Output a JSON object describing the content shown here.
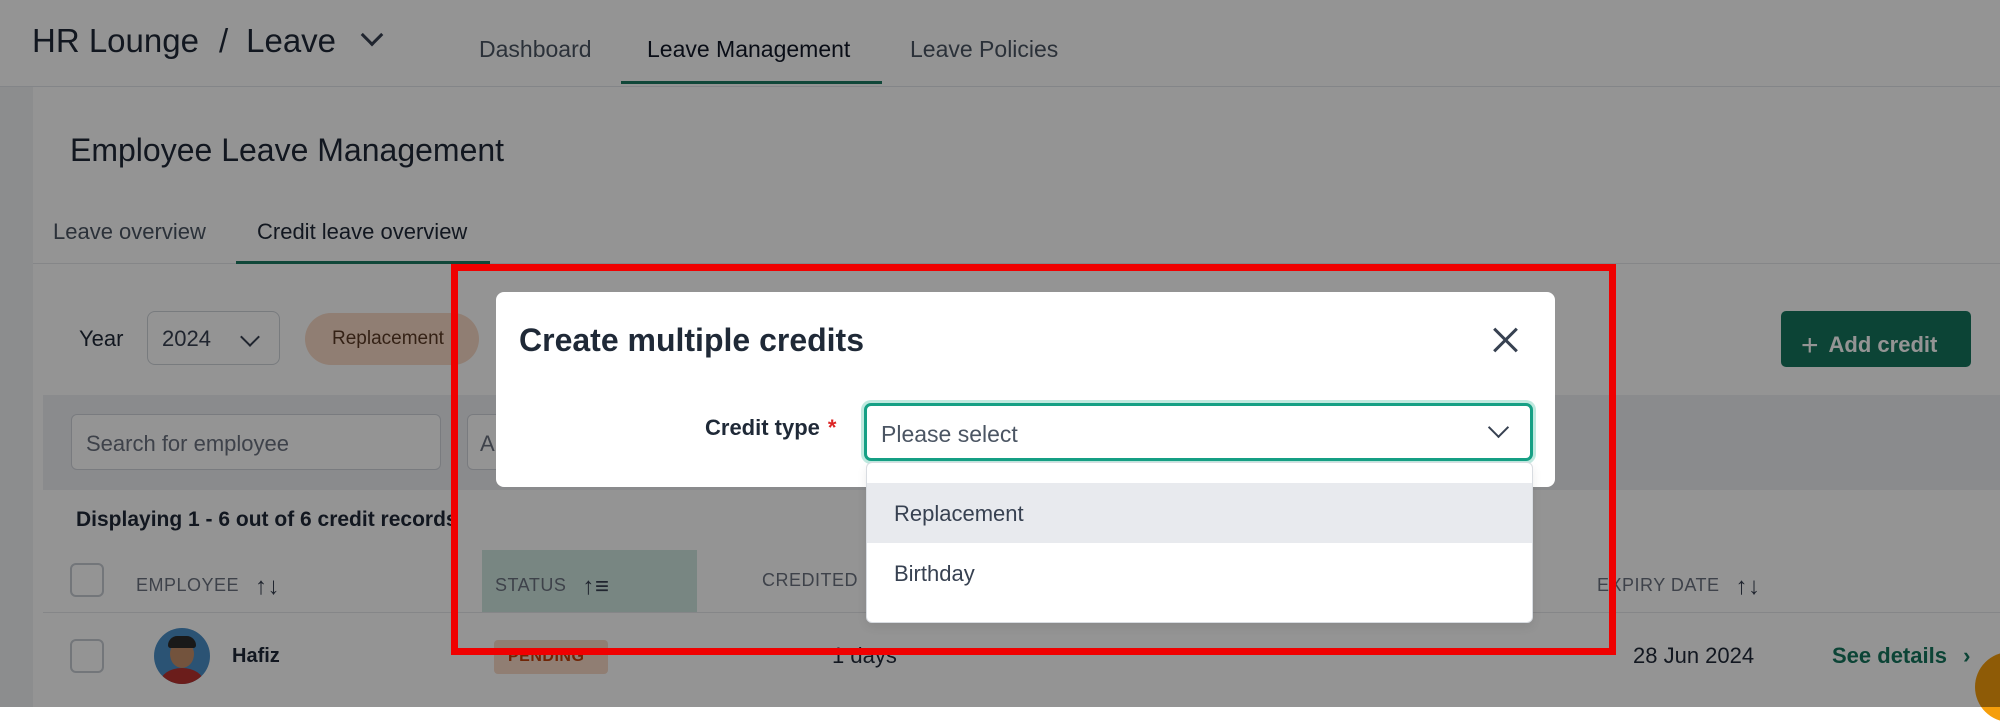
{
  "breadcrumb": {
    "home": "HR Lounge",
    "separator": "/",
    "section": "Leave"
  },
  "nav_tabs": [
    "Dashboard",
    "Leave Management",
    "Leave Policies"
  ],
  "page_title": "Employee Leave Management",
  "sub_tabs": [
    "Leave overview",
    "Credit leave overview"
  ],
  "filters": {
    "year_label": "Year",
    "year_value": "2024",
    "type_pill": "Replacement",
    "search_placeholder": "Search for employee",
    "second_search_placeholder": "A"
  },
  "add_credit_label": "Add credit",
  "display_text": "Displaying 1 - 6 out of 6 credit records",
  "table": {
    "headers": [
      "EMPLOYEE",
      "STATUS",
      "CREDITED",
      "EXPIRY DATE"
    ],
    "sort_icon": "↑↓",
    "status_sort_icon": "↑≡",
    "rows": [
      {
        "employee": "Hafiz",
        "status": "PENDING",
        "credited": "1 days",
        "expiry": "28 Jun 2024",
        "action": "See details",
        "action_icon": "›"
      }
    ]
  },
  "modal": {
    "title": "Create multiple credits",
    "credit_type_label": "Credit type",
    "required_mark": "*",
    "select_placeholder": "Please select",
    "options": [
      "Replacement",
      "Birthday"
    ]
  },
  "colors": {
    "accent": "#15765d",
    "highlight_box": "#f00000",
    "pending_badge": "#f8d9c6"
  }
}
